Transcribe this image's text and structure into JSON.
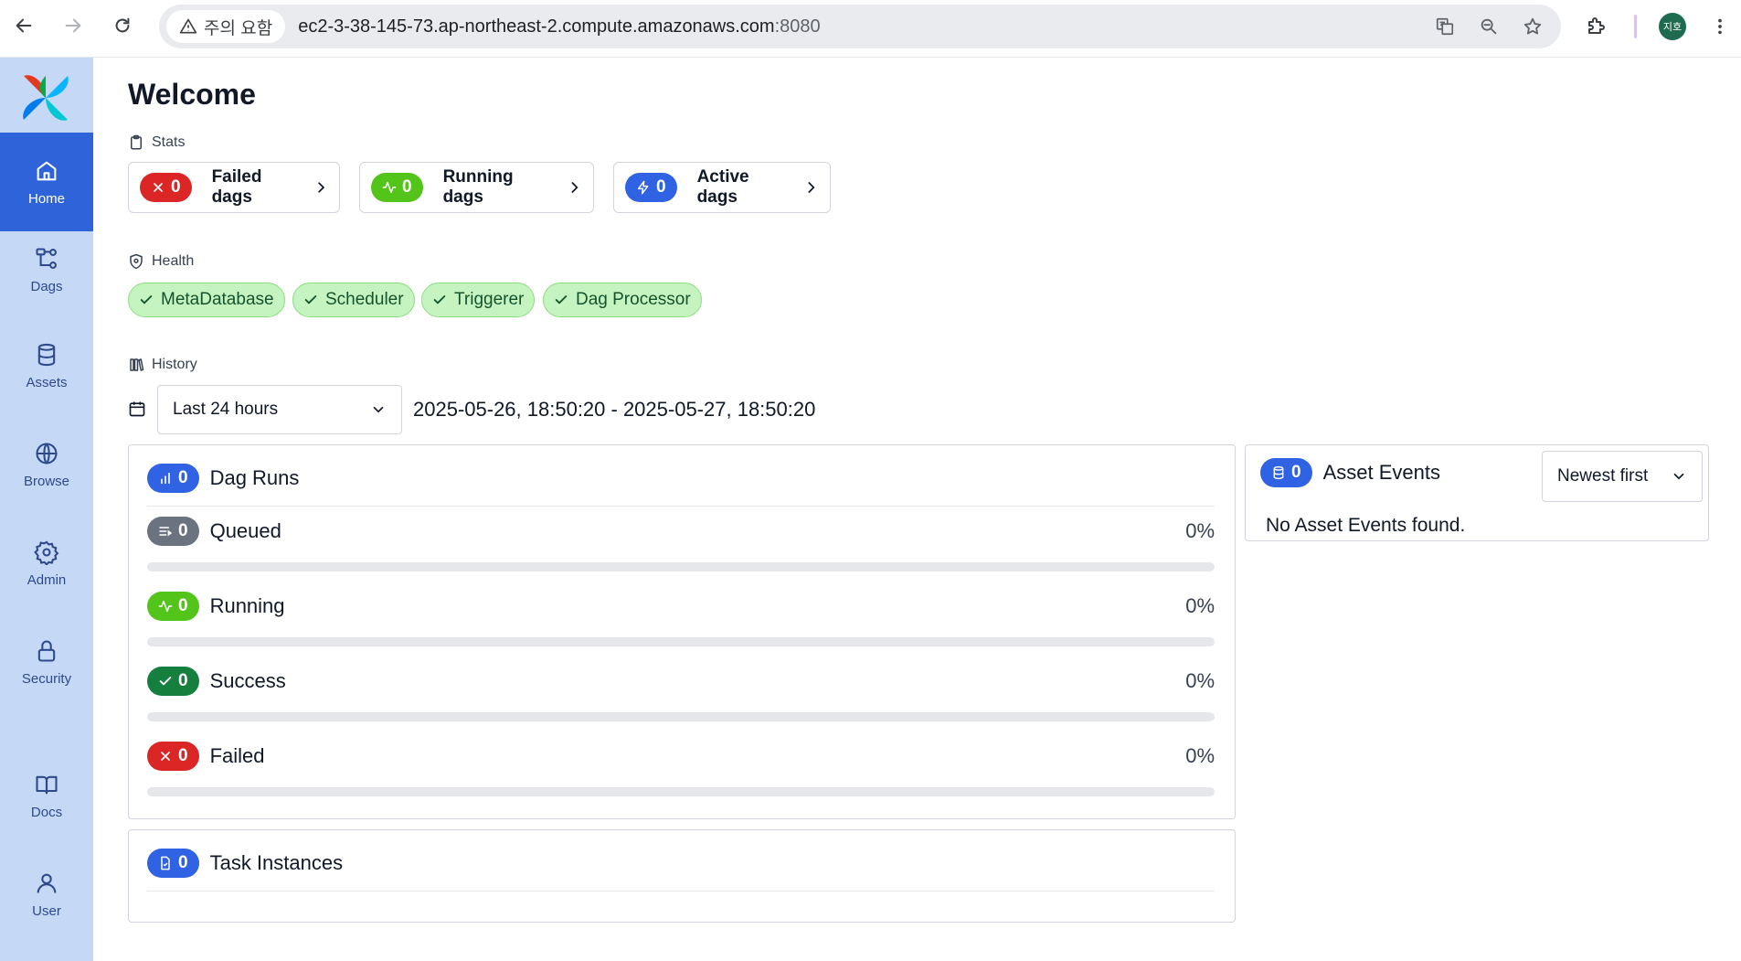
{
  "browser": {
    "warning_label": "주의 요함",
    "url_host": "ec2-3-38-145-73.ap-northeast-2.compute.amazonaws.com",
    "url_port": ":8080",
    "avatar_text": "지호"
  },
  "sidebar": {
    "items": [
      {
        "label": "Home",
        "icon": "home-icon",
        "active": true
      },
      {
        "label": "Dags",
        "icon": "dags-icon"
      },
      {
        "label": "Assets",
        "icon": "database-icon"
      },
      {
        "label": "Browse",
        "icon": "globe-icon"
      },
      {
        "label": "Admin",
        "icon": "gear-icon"
      },
      {
        "label": "Security",
        "icon": "lock-icon"
      },
      {
        "label": "Docs",
        "icon": "book-icon"
      },
      {
        "label": "User",
        "icon": "user-icon"
      }
    ]
  },
  "page": {
    "title": "Welcome",
    "stats_label": "Stats",
    "health_label": "Health",
    "history_label": "History"
  },
  "stats": [
    {
      "count": "0",
      "label": "Failed dags",
      "color": "#dc2626"
    },
    {
      "count": "0",
      "label": "Running dags",
      "color": "#53c41a"
    },
    {
      "count": "0",
      "label": "Active dags",
      "color": "#2f63e3"
    }
  ],
  "health": [
    "MetaDatabase",
    "Scheduler",
    "Triggerer",
    "Dag Processor"
  ],
  "history": {
    "range_select": "Last 24 hours",
    "range_text": "2025-05-26, 18:50:20 - 2025-05-27, 18:50:20"
  },
  "dag_runs": {
    "count": "0",
    "title": "Dag Runs",
    "rows": [
      {
        "label": "Queued",
        "count": "0",
        "pct": "0%",
        "fraction": 0
      },
      {
        "label": "Running",
        "count": "0",
        "pct": "0%",
        "fraction": 0
      },
      {
        "label": "Success",
        "count": "0",
        "pct": "0%",
        "fraction": 0
      },
      {
        "label": "Failed",
        "count": "0",
        "pct": "0%",
        "fraction": 0
      }
    ]
  },
  "task_instances": {
    "count": "0",
    "title": "Task Instances"
  },
  "asset_events": {
    "count": "0",
    "title": "Asset Events",
    "sort": "Newest first",
    "empty": "No Asset Events found."
  }
}
